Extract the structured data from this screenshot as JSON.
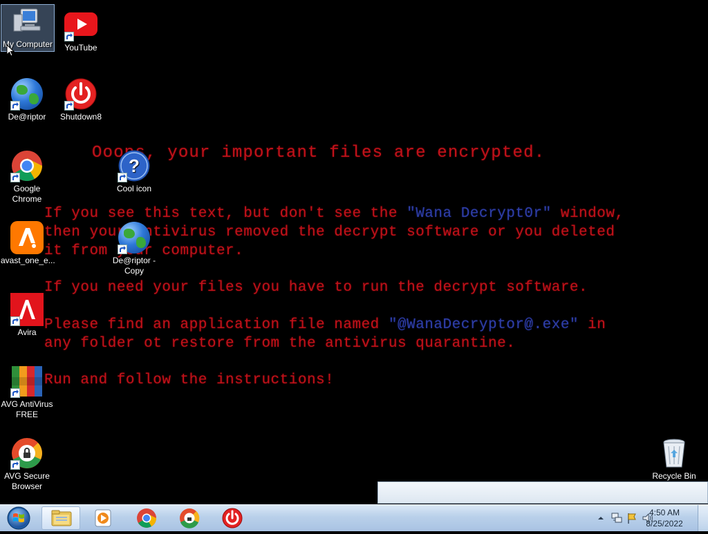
{
  "desktop": {
    "ransom_note": {
      "title": "Ooops, your important files are encrypted.",
      "p1_a": "If you see this text, but don't see the ",
      "p1_b": "\"Wana Decrypt0r\"",
      "p1_c": " window,",
      "p1_line2": "then your antivirus removed the decrypt software or you deleted",
      "p1_line3": "it from your computer.",
      "p2": "If you need your files you have to run the decrypt software.",
      "p3_a": "Please find an application file named ",
      "p3_b": "\"@WanaDecryptor@.exe\"",
      "p3_c": " in",
      "p3_line2": "any folder ot restore from the antivirus quarantine.",
      "p4": "Run and follow the instructions!",
      "text_color": "#c0121a",
      "highlight_color": "#2f3fa8"
    },
    "icons": {
      "my_computer": "My Computer",
      "youtube": "YouTube",
      "deriptor": "De@riptor",
      "shutdown8": "Shutdown8",
      "chrome_line1": "Google",
      "chrome_line2": "Chrome",
      "cool_icon": "Cool icon",
      "avast": "avast_one_e...",
      "deriptor_copy_line1": "De@riptor -",
      "deriptor_copy_line2": "Copy",
      "avira": "Avira",
      "avg_av_line1": "AVG AntiVirus",
      "avg_av_line2": "FREE",
      "avg_browser_line1": "AVG Secure",
      "avg_browser_line2": "Browser",
      "recycle_bin": "Recycle Bin"
    }
  },
  "taskbar": {
    "time": "4:50 AM",
    "date": "8/25/2022",
    "pinned": [
      "start-button",
      "file-explorer",
      "media-player",
      "google-chrome",
      "avg-secure-browser",
      "shutdown8"
    ]
  }
}
